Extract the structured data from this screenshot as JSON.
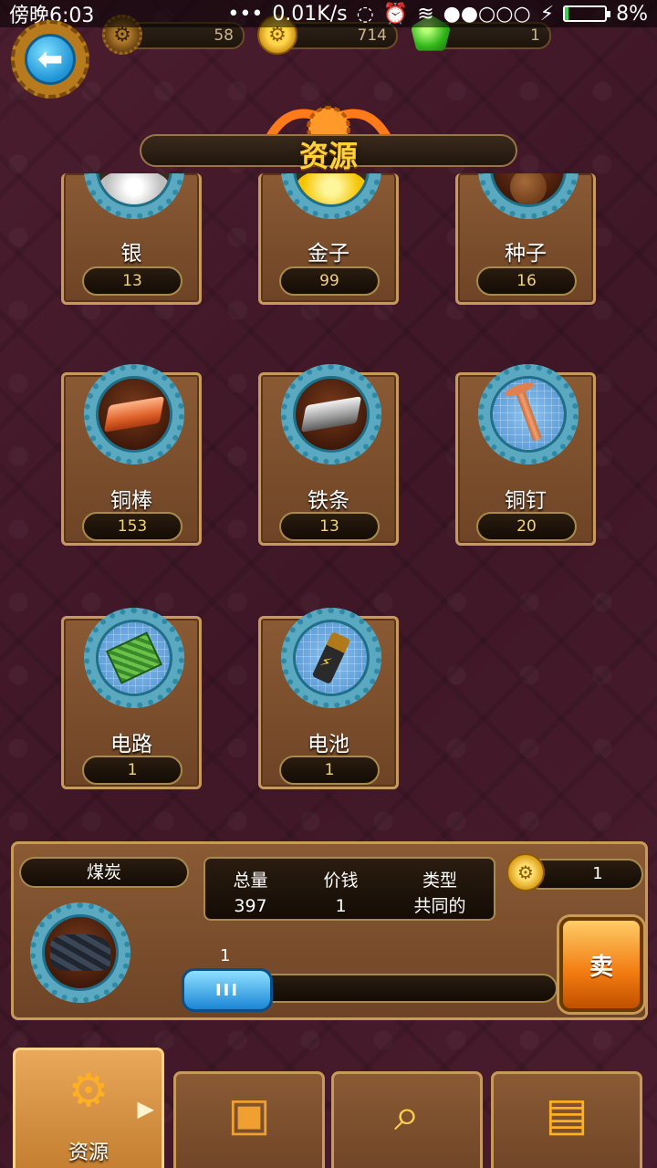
{
  "status_bar": {
    "time": "傍晚6:03",
    "network_speed": "0.01K/s",
    "battery_percent": "8%",
    "battery_level": 0.08
  },
  "resources": {
    "gears": "58",
    "coins": "714",
    "gems": "1"
  },
  "title": "资源",
  "items": [
    {
      "name": "银",
      "count": "13",
      "icon": "silver-icon"
    },
    {
      "name": "金子",
      "count": "99",
      "icon": "gold-icon"
    },
    {
      "name": "种子",
      "count": "16",
      "icon": "seed-icon"
    },
    {
      "name": "铜棒",
      "count": "153",
      "icon": "copper-bar-icon"
    },
    {
      "name": "铁条",
      "count": "13",
      "icon": "iron-bar-icon"
    },
    {
      "name": "铜钉",
      "count": "20",
      "icon": "copper-nail-icon"
    },
    {
      "name": "电路",
      "count": "1",
      "icon": "circuit-icon"
    },
    {
      "name": "电池",
      "count": "1",
      "icon": "battery-icon"
    }
  ],
  "detail": {
    "name": "煤炭",
    "total_label": "总量",
    "total_value": "397",
    "price_label": "价钱",
    "price_value": "1",
    "type_label": "类型",
    "type_value": "共同的",
    "coin_value": "1",
    "slider_value": "1",
    "slider_handle": "III",
    "sell_label": "卖"
  },
  "tabs": [
    {
      "label": "资源",
      "icon": "gear-icon",
      "active": true
    },
    {
      "label": "",
      "icon": "mystery-box-icon",
      "active": false
    },
    {
      "label": "",
      "icon": "magnifier-icon",
      "active": false
    },
    {
      "label": "",
      "icon": "chest-icon",
      "active": false
    }
  ]
}
